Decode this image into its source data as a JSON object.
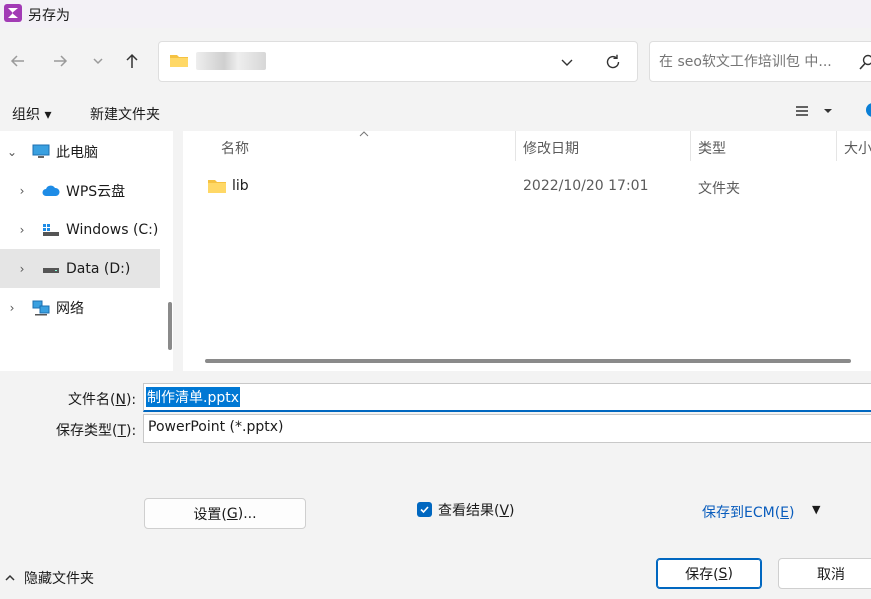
{
  "window": {
    "title": "另存为"
  },
  "nav": {
    "address_path": "·  ·  ·",
    "search_placeholder": "在 seo软文工作培训包 中..."
  },
  "toolbar": {
    "organize": "组织 ▾",
    "new_folder": "新建文件夹"
  },
  "tree": [
    {
      "label": "此电脑",
      "icon": "computer-icon"
    },
    {
      "label": "WPS云盘",
      "icon": "cloud-icon"
    },
    {
      "label": "Windows (C:)",
      "icon": "windows-drive-icon"
    },
    {
      "label": "Data (D:)",
      "icon": "drive-icon"
    },
    {
      "label": "网络",
      "icon": "network-icon"
    }
  ],
  "columns": {
    "name": "名称",
    "date": "修改日期",
    "type": "类型",
    "size": "大小"
  },
  "files": [
    {
      "name": "lib",
      "date": "2022/10/20 17:01",
      "type": "文件夹"
    }
  ],
  "form": {
    "filename_label": "文件名(",
    "filename_key": "N",
    "filename_label_end": "):",
    "filename_value": "制作清单.pptx",
    "filetype_label": "保存类型(",
    "filetype_key": "T",
    "filetype_label_end": "):",
    "filetype_value": "PowerPoint (*.pptx)",
    "settings_label": "设置(",
    "settings_key": "G",
    "settings_end": ")...",
    "view_result": "查看结果(",
    "view_key": "V",
    "view_end": ")",
    "ecm": "保存到ECM(",
    "ecm_key": "E",
    "ecm_end": ")"
  },
  "footer": {
    "hide_folders": "隐藏文件夹",
    "save": "保存(",
    "save_key": "S",
    "save_end": ")",
    "cancel": "取消"
  },
  "colors": {
    "accent": "#0067c0",
    "selection": "#0078d4",
    "link": "#0a5dbd"
  }
}
